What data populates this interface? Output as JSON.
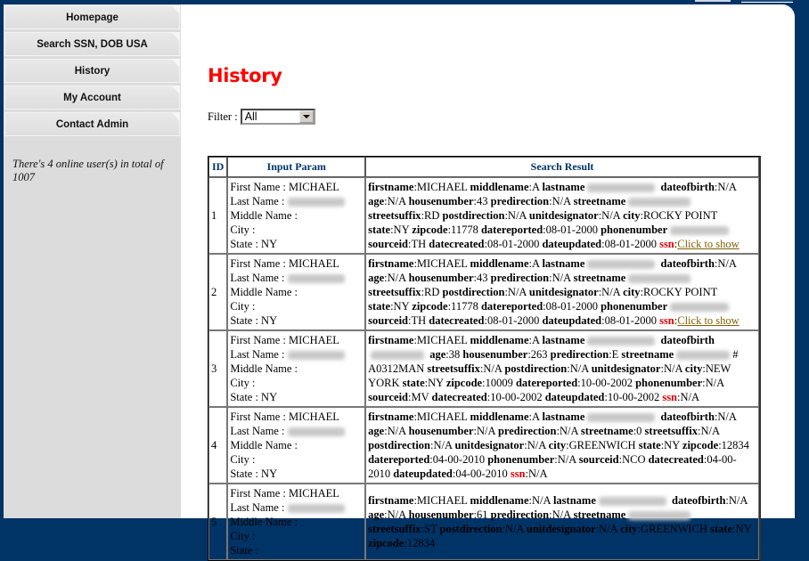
{
  "sidebar": {
    "menu": [
      {
        "label": "Homepage"
      },
      {
        "label": "Search SSN, DOB USA"
      },
      {
        "label": "History"
      },
      {
        "label": "My Account"
      },
      {
        "label": "Contact Admin"
      }
    ],
    "online_text": "There's 4 online user(s) in total of 1007"
  },
  "page": {
    "title": "History",
    "filter_label": "Filter :",
    "filter_value": "All"
  },
  "table": {
    "headers": [
      "ID",
      "Input Param",
      "Search Result"
    ],
    "input_labels": {
      "first": "First Name : ",
      "last": "Last Name : ",
      "middle": "Middle Name :",
      "city": "City :",
      "state": "State : "
    },
    "ssn_link_text": "Click to show",
    "rows": [
      {
        "id": "1",
        "first_name": "MICHAEL",
        "state": "NY",
        "fields": [
          [
            "firstname",
            "MICHAEL"
          ],
          [
            "middlename",
            "A"
          ],
          [
            "lastname",
            null
          ],
          [
            "dateofbirth",
            "N/A"
          ],
          [
            "age",
            "N/A"
          ],
          [
            "housenumber",
            "43"
          ],
          [
            "predirection",
            "N/A"
          ],
          [
            "streetname",
            null
          ],
          [
            "streetsuffix",
            "RD"
          ],
          [
            "postdirection",
            "N/A"
          ],
          [
            "unitdesignator",
            "N/A"
          ],
          [
            "city",
            "ROCKY POINT"
          ],
          [
            "state",
            "NY"
          ],
          [
            "zipcode",
            "11778"
          ],
          [
            "datereported",
            "08-01-2000"
          ],
          [
            "phonenumber",
            null
          ],
          [
            "sourceid",
            "TH"
          ],
          [
            "datecreated",
            "08-01-2000"
          ],
          [
            "dateupdated",
            "08-01-2000"
          ]
        ],
        "ssn": "link"
      },
      {
        "id": "2",
        "first_name": "MICHAEL",
        "state": "NY",
        "fields": [
          [
            "firstname",
            "MICHAEL"
          ],
          [
            "middlename",
            "A"
          ],
          [
            "lastname",
            null
          ],
          [
            "dateofbirth",
            "N/A"
          ],
          [
            "age",
            "N/A"
          ],
          [
            "housenumber",
            "43"
          ],
          [
            "predirection",
            "N/A"
          ],
          [
            "streetname",
            null
          ],
          [
            "streetsuffix",
            "RD"
          ],
          [
            "postdirection",
            "N/A"
          ],
          [
            "unitdesignator",
            "N/A"
          ],
          [
            "city",
            "ROCKY POINT"
          ],
          [
            "state",
            "NY"
          ],
          [
            "zipcode",
            "11778"
          ],
          [
            "datereported",
            "08-01-2000"
          ],
          [
            "phonenumber",
            null
          ],
          [
            "sourceid",
            "TH"
          ],
          [
            "datecreated",
            "08-01-2000"
          ],
          [
            "dateupdated",
            "08-01-2000"
          ]
        ],
        "ssn": "link"
      },
      {
        "id": "3",
        "first_name": "MICHAEL",
        "state": "NY",
        "fields": [
          [
            "firstname",
            "MICHAEL"
          ],
          [
            "middlename",
            "A"
          ],
          [
            "lastname",
            null
          ],
          [
            "dateofbirth",
            null
          ],
          [
            "age",
            "38"
          ],
          [
            "housenumber",
            "263"
          ],
          [
            "predirection",
            "E"
          ],
          [
            "streetname",
            "# A0312MAN",
            true
          ],
          [
            "streetsuffix",
            "N/A"
          ],
          [
            "postdirection",
            "N/A"
          ],
          [
            "unitdesignator",
            "N/A"
          ],
          [
            "city",
            "NEW YORK"
          ],
          [
            "state",
            "NY"
          ],
          [
            "zipcode",
            "10009"
          ],
          [
            "datereported",
            "10-00-2002"
          ],
          [
            "phonenumber",
            "N/A"
          ],
          [
            "sourceid",
            "MV"
          ],
          [
            "datecreated",
            "10-00-2002"
          ],
          [
            "dateupdated",
            "10-00-2002"
          ]
        ],
        "ssn": "N/A"
      },
      {
        "id": "4",
        "first_name": "MICHAEL",
        "state": "NY",
        "fields": [
          [
            "firstname",
            "MICHAEL"
          ],
          [
            "middlename",
            "A"
          ],
          [
            "lastname",
            null
          ],
          [
            "dateofbirth",
            "N/A"
          ],
          [
            "age",
            "N/A"
          ],
          [
            "housenumber",
            "N/A"
          ],
          [
            "predirection",
            "N/A"
          ],
          [
            "streetname",
            "0"
          ],
          [
            "streetsuffix",
            "N/A"
          ],
          [
            "postdirection",
            "N/A"
          ],
          [
            "unitdesignator",
            "N/A"
          ],
          [
            "city",
            "GREENWICH"
          ],
          [
            "state",
            "NY"
          ],
          [
            "zipcode",
            "12834"
          ],
          [
            "datereported",
            "04-00-2010"
          ],
          [
            "phonenumber",
            "N/A"
          ],
          [
            "sourceid",
            "NCO"
          ],
          [
            "datecreated",
            "04-00-2010"
          ],
          [
            "dateupdated",
            "04-00-2010"
          ]
        ],
        "ssn": "N/A"
      },
      {
        "id": "5",
        "first_name": "MICHAEL",
        "state": "",
        "fields": [
          [
            "firstname",
            "MICHAEL"
          ],
          [
            "middlename",
            "N/A"
          ],
          [
            "lastname",
            null
          ],
          [
            "dateofbirth",
            "N/A"
          ],
          [
            "age",
            "N/A"
          ],
          [
            "housenumber",
            "61"
          ],
          [
            "predirection",
            "N/A"
          ],
          [
            "streetname",
            null
          ],
          [
            "streetsuffix",
            "ST"
          ],
          [
            "postdirection",
            "N/A"
          ],
          [
            "unitdesignator",
            "N/A"
          ],
          [
            "city",
            "GREENWICH"
          ],
          [
            "state",
            "NY"
          ],
          [
            "zipcode",
            "12834"
          ]
        ],
        "ssn": ""
      }
    ]
  },
  "colors": {
    "navy": "#003366",
    "title_red": "#ff0000",
    "ssn_red": "#e00000",
    "link_brown": "#806000",
    "sidebar_grey": "#dcdcdc"
  }
}
